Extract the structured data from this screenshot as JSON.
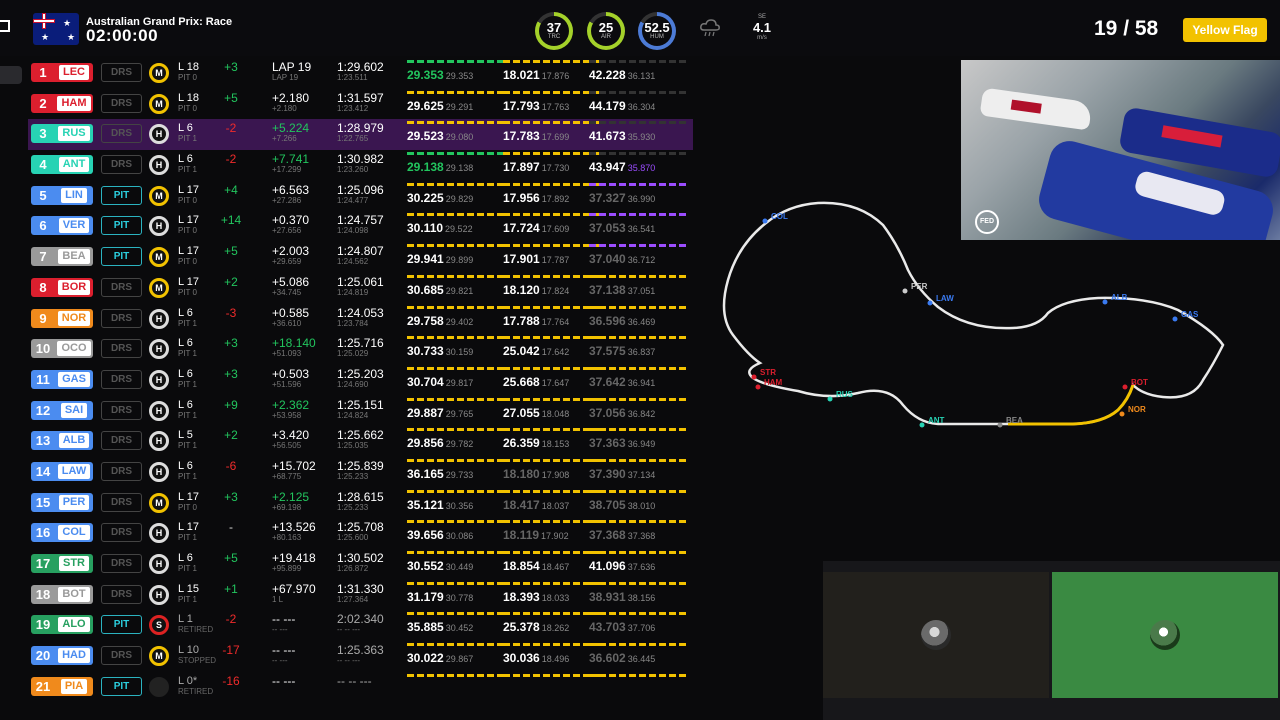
{
  "header": {
    "race_title": "Australian Grand Prix: Race",
    "race_clock": "02:00:00",
    "flag_stars": [
      "★",
      "★",
      "★"
    ],
    "gauges": [
      {
        "value": "37",
        "label": "TRC",
        "color": "#a4d12a"
      },
      {
        "value": "25",
        "label": "AIR",
        "color": "#a4d12a"
      },
      {
        "value": "52.5",
        "label": "HUM",
        "color": "#4c7bd6"
      }
    ],
    "wind": {
      "direction": "SE",
      "value": "4.1",
      "unit": "m/s"
    },
    "lap_count": "19 / 58",
    "flag_status": "Yellow Flag"
  },
  "standings": [
    {
      "pos": "1",
      "code": "LEC",
      "team": "#dc1f2e",
      "drs": "DRS",
      "tyre": "M",
      "lap": "L 18",
      "pit": "PIT 0",
      "delta": "+3",
      "dcls": "g",
      "gap": "LAP 19",
      "gap_sub": "LAP 19",
      "gcls": "",
      "last": "1:29.602",
      "last_sub": "1:23.511",
      "s1": "29.353",
      "s1r": "29.353",
      "s1c": "g",
      "s1b": "g",
      "s2": "18.021",
      "s2r": "17.876",
      "s2c": "",
      "s2b": "",
      "s3": "42.228",
      "s3r": "36.131",
      "s3c": "",
      "s3b": "x"
    },
    {
      "pos": "2",
      "code": "HAM",
      "team": "#dc1f2e",
      "drs": "DRS",
      "tyre": "M",
      "lap": "L 18",
      "pit": "PIT 0",
      "delta": "+5",
      "dcls": "g",
      "gap": "+2.180",
      "gap_sub": "+2.180",
      "gcls": "",
      "last": "1:31.597",
      "last_sub": "1:23.412",
      "s1": "29.625",
      "s1r": "29.291",
      "s1c": "",
      "s1b": "",
      "s2": "17.793",
      "s2r": "17.763",
      "s2c": "",
      "s2b": "",
      "s3": "44.179",
      "s3r": "36.304",
      "s3c": "",
      "s3b": "x"
    },
    {
      "pos": "3",
      "code": "RUS",
      "team": "#27d3b4",
      "drs": "DRS",
      "tyre": "H",
      "lap": "L 6",
      "pit": "PIT 1",
      "delta": "-2",
      "dcls": "r",
      "gap": "+5.224",
      "gap_sub": "+7.266",
      "gcls": "g",
      "last": "1:28.979",
      "last_sub": "1:22.765",
      "s1": "29.523",
      "s1r": "29.080",
      "s1c": "",
      "s1b": "",
      "s2": "17.783",
      "s2r": "17.699",
      "s2c": "",
      "s2b": "",
      "s3": "41.673",
      "s3r": "35.930",
      "s3c": "",
      "s3b": "x",
      "hl": true
    },
    {
      "pos": "4",
      "code": "ANT",
      "team": "#27d3b4",
      "drs": "DRS",
      "tyre": "H",
      "lap": "L 6",
      "pit": "PIT 1",
      "delta": "-2",
      "dcls": "r",
      "gap": "+7.741",
      "gap_sub": "+17.299",
      "gcls": "g",
      "last": "1:30.982",
      "last_sub": "1:23.260",
      "s1": "29.138",
      "s1r": "29.138",
      "s1c": "g",
      "s1b": "g",
      "s2": "17.897",
      "s2r": "17.730",
      "s2c": "",
      "s2b": "",
      "s3": "43.947",
      "s3r": "35.870",
      "s3c": "",
      "s3b": "x",
      "s3rp": true
    },
    {
      "pos": "5",
      "code": "LIN",
      "team": "#4b8cf0",
      "drs": "PIT",
      "tyre": "M",
      "lap": "L 17",
      "pit": "PIT 0",
      "delta": "+4",
      "dcls": "g",
      "gap": "+6.563",
      "gap_sub": "+27.286",
      "gcls": "",
      "last": "1:25.096",
      "last_sub": "1:24.477",
      "s1": "30.225",
      "s1r": "29.829",
      "s1c": "",
      "s1b": "",
      "s2": "17.956",
      "s2r": "17.892",
      "s2c": "",
      "s2b": "",
      "s3": "37.327",
      "s3r": "36.990",
      "s3c": "dim",
      "s3b": "p"
    },
    {
      "pos": "6",
      "code": "VER",
      "team": "#4b8cf0",
      "drs": "PIT",
      "tyre": "H",
      "lap": "L 17",
      "pit": "PIT 0",
      "delta": "+14",
      "dcls": "g",
      "gap": "+0.370",
      "gap_sub": "+27.656",
      "gcls": "",
      "last": "1:24.757",
      "last_sub": "1:24.098",
      "s1": "30.110",
      "s1r": "29.522",
      "s1c": "",
      "s1b": "",
      "s2": "17.724",
      "s2r": "17.609",
      "s2c": "",
      "s2b": "",
      "s3": "37.053",
      "s3r": "36.541",
      "s3c": "dim",
      "s3b": "p"
    },
    {
      "pos": "7",
      "code": "BEA",
      "team": "#9a9a9a",
      "drs": "PIT",
      "tyre": "M",
      "lap": "L 17",
      "pit": "PIT 0",
      "delta": "+5",
      "dcls": "g",
      "gap": "+2.003",
      "gap_sub": "+29.659",
      "gcls": "",
      "last": "1:24.807",
      "last_sub": "1:24.562",
      "s1": "29.941",
      "s1r": "29.899",
      "s1c": "",
      "s1b": "",
      "s2": "17.901",
      "s2r": "17.787",
      "s2c": "",
      "s2b": "",
      "s3": "37.040",
      "s3r": "36.712",
      "s3c": "dim",
      "s3b": "p"
    },
    {
      "pos": "8",
      "code": "BOR",
      "team": "#dc1f2e",
      "drs": "DRS",
      "tyre": "M",
      "lap": "L 17",
      "pit": "PIT 0",
      "delta": "+2",
      "dcls": "g",
      "gap": "+5.086",
      "gap_sub": "+34.745",
      "gcls": "",
      "last": "1:25.061",
      "last_sub": "1:24.819",
      "s1": "30.685",
      "s1r": "29.821",
      "s1c": "",
      "s1b": "",
      "s2": "18.120",
      "s2r": "17.824",
      "s2c": "",
      "s2b": "",
      "s3": "37.138",
      "s3r": "37.051",
      "s3c": "dim",
      "s3b": ""
    },
    {
      "pos": "9",
      "code": "NOR",
      "team": "#f08a1c",
      "drs": "DRS",
      "tyre": "H",
      "lap": "L 6",
      "pit": "PIT 1",
      "delta": "-3",
      "dcls": "r",
      "gap": "+0.585",
      "gap_sub": "+36.610",
      "gcls": "",
      "last": "1:24.053",
      "last_sub": "1:23.784",
      "s1": "29.758",
      "s1r": "29.402",
      "s1c": "",
      "s1b": "",
      "s2": "17.788",
      "s2r": "17.764",
      "s2c": "",
      "s2b": "",
      "s3": "36.596",
      "s3r": "36.469",
      "s3c": "dim",
      "s3b": ""
    },
    {
      "pos": "10",
      "code": "OCO",
      "team": "#9a9a9a",
      "drs": "DRS",
      "tyre": "H",
      "lap": "L 6",
      "pit": "PIT 1",
      "delta": "+3",
      "dcls": "g",
      "gap": "+18.140",
      "gap_sub": "+51.093",
      "gcls": "g",
      "last": "1:25.716",
      "last_sub": "1:25.029",
      "s1": "30.733",
      "s1r": "30.159",
      "s1c": "",
      "s1b": "",
      "s2": "25.042",
      "s2r": "17.642",
      "s2c": "",
      "s2b": "",
      "s3": "37.575",
      "s3r": "36.837",
      "s3c": "dim",
      "s3b": ""
    },
    {
      "pos": "11",
      "code": "GAS",
      "team": "#4b8cf0",
      "drs": "DRS",
      "tyre": "H",
      "lap": "L 6",
      "pit": "PIT 1",
      "delta": "+3",
      "dcls": "g",
      "gap": "+0.503",
      "gap_sub": "+51.596",
      "gcls": "",
      "last": "1:25.203",
      "last_sub": "1:24.690",
      "s1": "30.704",
      "s1r": "29.817",
      "s1c": "",
      "s1b": "",
      "s2": "25.668",
      "s2r": "17.647",
      "s2c": "",
      "s2b": "",
      "s3": "37.642",
      "s3r": "36.941",
      "s3c": "dim",
      "s3b": ""
    },
    {
      "pos": "12",
      "code": "SAI",
      "team": "#4b8cf0",
      "drs": "DRS",
      "tyre": "H",
      "lap": "L 6",
      "pit": "PIT 1",
      "delta": "+9",
      "dcls": "g",
      "gap": "+2.362",
      "gap_sub": "+53.958",
      "gcls": "g",
      "last": "1:25.151",
      "last_sub": "1:24.824",
      "s1": "29.887",
      "s1r": "29.765",
      "s1c": "",
      "s1b": "",
      "s2": "27.055",
      "s2r": "18.048",
      "s2c": "",
      "s2b": "",
      "s3": "37.056",
      "s3r": "36.842",
      "s3c": "dim",
      "s3b": ""
    },
    {
      "pos": "13",
      "code": "ALB",
      "team": "#4b8cf0",
      "drs": "DRS",
      "tyre": "H",
      "lap": "L 5",
      "pit": "PIT 1",
      "delta": "+2",
      "dcls": "g",
      "gap": "+3.420",
      "gap_sub": "+56.505",
      "gcls": "",
      "last": "1:25.662",
      "last_sub": "1:25.035",
      "s1": "29.856",
      "s1r": "29.782",
      "s1c": "",
      "s1b": "",
      "s2": "26.359",
      "s2r": "18.153",
      "s2c": "",
      "s2b": "",
      "s3": "37.363",
      "s3r": "36.949",
      "s3c": "dim",
      "s3b": ""
    },
    {
      "pos": "14",
      "code": "LAW",
      "team": "#4b8cf0",
      "drs": "DRS",
      "tyre": "H",
      "lap": "L 6",
      "pit": "PIT 1",
      "delta": "-6",
      "dcls": "r",
      "gap": "+15.702",
      "gap_sub": "+68.775",
      "gcls": "",
      "last": "1:25.839",
      "last_sub": "1:25.233",
      "s1": "36.165",
      "s1r": "29.733",
      "s1c": "",
      "s1b": "",
      "s2": "18.180",
      "s2r": "17.908",
      "s2c": "dim",
      "s2b": "",
      "s3": "37.390",
      "s3r": "37.134",
      "s3c": "dim",
      "s3b": ""
    },
    {
      "pos": "15",
      "code": "PER",
      "team": "#4b8cf0",
      "drs": "DRS",
      "tyre": "M",
      "lap": "L 17",
      "pit": "PIT 0",
      "delta": "+3",
      "dcls": "g",
      "gap": "+2.125",
      "gap_sub": "+69.198",
      "gcls": "g",
      "last": "1:28.615",
      "last_sub": "1:25.233",
      "s1": "35.121",
      "s1r": "30.356",
      "s1c": "",
      "s1b": "",
      "s2": "18.417",
      "s2r": "18.037",
      "s2c": "dim",
      "s2b": "",
      "s3": "38.705",
      "s3r": "38.010",
      "s3c": "dim",
      "s3b": ""
    },
    {
      "pos": "16",
      "code": "COL",
      "team": "#4b8cf0",
      "drs": "DRS",
      "tyre": "H",
      "lap": "L 17",
      "pit": "PIT 1",
      "delta": "-",
      "dcls": "w",
      "gap": "+13.526",
      "gap_sub": "+80.163",
      "gcls": "",
      "last": "1:25.708",
      "last_sub": "1:25.600",
      "s1": "39.656",
      "s1r": "30.086",
      "s1c": "",
      "s1b": "",
      "s2": "18.119",
      "s2r": "17.902",
      "s2c": "dim",
      "s2b": "",
      "s3": "37.368",
      "s3r": "37.368",
      "s3c": "dim",
      "s3b": ""
    },
    {
      "pos": "17",
      "code": "STR",
      "team": "#27a060",
      "drs": "DRS",
      "tyre": "H",
      "lap": "L 6",
      "pit": "PIT 1",
      "delta": "+5",
      "dcls": "g",
      "gap": "+19.418",
      "gap_sub": "+95.899",
      "gcls": "",
      "last": "1:30.502",
      "last_sub": "1:26.872",
      "s1": "30.552",
      "s1r": "30.449",
      "s1c": "",
      "s1b": "",
      "s2": "18.854",
      "s2r": "18.467",
      "s2c": "",
      "s2b": "",
      "s3": "41.096",
      "s3r": "37.636",
      "s3c": "",
      "s3b": ""
    },
    {
      "pos": "18",
      "code": "BOT",
      "team": "#9a9a9a",
      "drs": "DRS",
      "tyre": "H",
      "lap": "L 15",
      "pit": "PIT 1",
      "delta": "+1",
      "dcls": "g",
      "gap": "+67.970",
      "gap_sub": "1 L",
      "gcls": "",
      "last": "1:31.330",
      "last_sub": "1:27.364",
      "s1": "31.179",
      "s1r": "30.778",
      "s1c": "",
      "s1b": "",
      "s2": "18.393",
      "s2r": "18.033",
      "s2c": "",
      "s2b": "",
      "s3": "38.931",
      "s3r": "38.156",
      "s3c": "dim",
      "s3b": ""
    },
    {
      "pos": "19",
      "code": "ALO",
      "team": "#27a060",
      "drs": "PIT",
      "tyre": "S",
      "lap": "L 1",
      "pit": "RETIRED",
      "delta": "-2",
      "dcls": "r",
      "gap": "-- ---",
      "gap_sub": "-- ---",
      "gcls": "",
      "last": "2:02.340",
      "last_sub": "-- -- ---",
      "s1": "35.885",
      "s1r": "30.452",
      "s1c": "",
      "s1b": "",
      "s2": "25.378",
      "s2r": "18.262",
      "s2c": "",
      "s2b": "",
      "s3": "43.703",
      "s3r": "37.706",
      "s3c": "dim",
      "s3b": "",
      "retired": true
    },
    {
      "pos": "20",
      "code": "HAD",
      "team": "#4b8cf0",
      "drs": "DRS",
      "tyre": "M",
      "lap": "L 10",
      "pit": "STOPPED",
      "delta": "-17",
      "dcls": "r",
      "gap": "-- ---",
      "gap_sub": "-- ---",
      "gcls": "",
      "last": "1:25.363",
      "last_sub": "-- -- ---",
      "s1": "30.022",
      "s1r": "29.867",
      "s1c": "",
      "s1b": "",
      "s2": "30.036",
      "s2r": "18.496",
      "s2c": "",
      "s2b": "",
      "s3": "36.602",
      "s3r": "36.445",
      "s3c": "dim",
      "s3b": "",
      "retired": true
    },
    {
      "pos": "21",
      "code": "PIA",
      "team": "#f08a1c",
      "drs": "PIT",
      "tyre": "",
      "lap": "L 0*",
      "pit": "RETIRED",
      "delta": "-16",
      "dcls": "r",
      "gap": "-- ---",
      "gap_sub": "",
      "gcls": "",
      "last": "-- -- ---",
      "last_sub": "",
      "s1": "",
      "s1r": "",
      "s1c": "",
      "s1b": "",
      "s2": "",
      "s2r": "",
      "s2c": "",
      "s2b": "",
      "s3": "",
      "s3r": "",
      "s3c": "",
      "s3b": "",
      "retired": true,
      "partial": true
    }
  ],
  "track_labels": [
    {
      "code": "COL",
      "color": "#3a7af0"
    },
    {
      "code": "PER",
      "color": "#cccccc"
    },
    {
      "code": "LAW",
      "color": "#3a7af0"
    },
    {
      "code": "ALB",
      "color": "#3a7af0"
    },
    {
      "code": "GAS",
      "color": "#3a7af0"
    },
    {
      "code": "BOT",
      "color": "#dc1f2e"
    },
    {
      "code": "NOR",
      "color": "#f08a1c"
    },
    {
      "code": "BEA",
      "color": "#888888"
    },
    {
      "code": "ANT",
      "color": "#27d3b4"
    },
    {
      "code": "RUS",
      "color": "#27d3b4"
    },
    {
      "code": "STR",
      "color": "#dc1f2e"
    },
    {
      "code": "HAM",
      "color": "#dc1f2e"
    }
  ],
  "video": {
    "logo": "FED"
  }
}
